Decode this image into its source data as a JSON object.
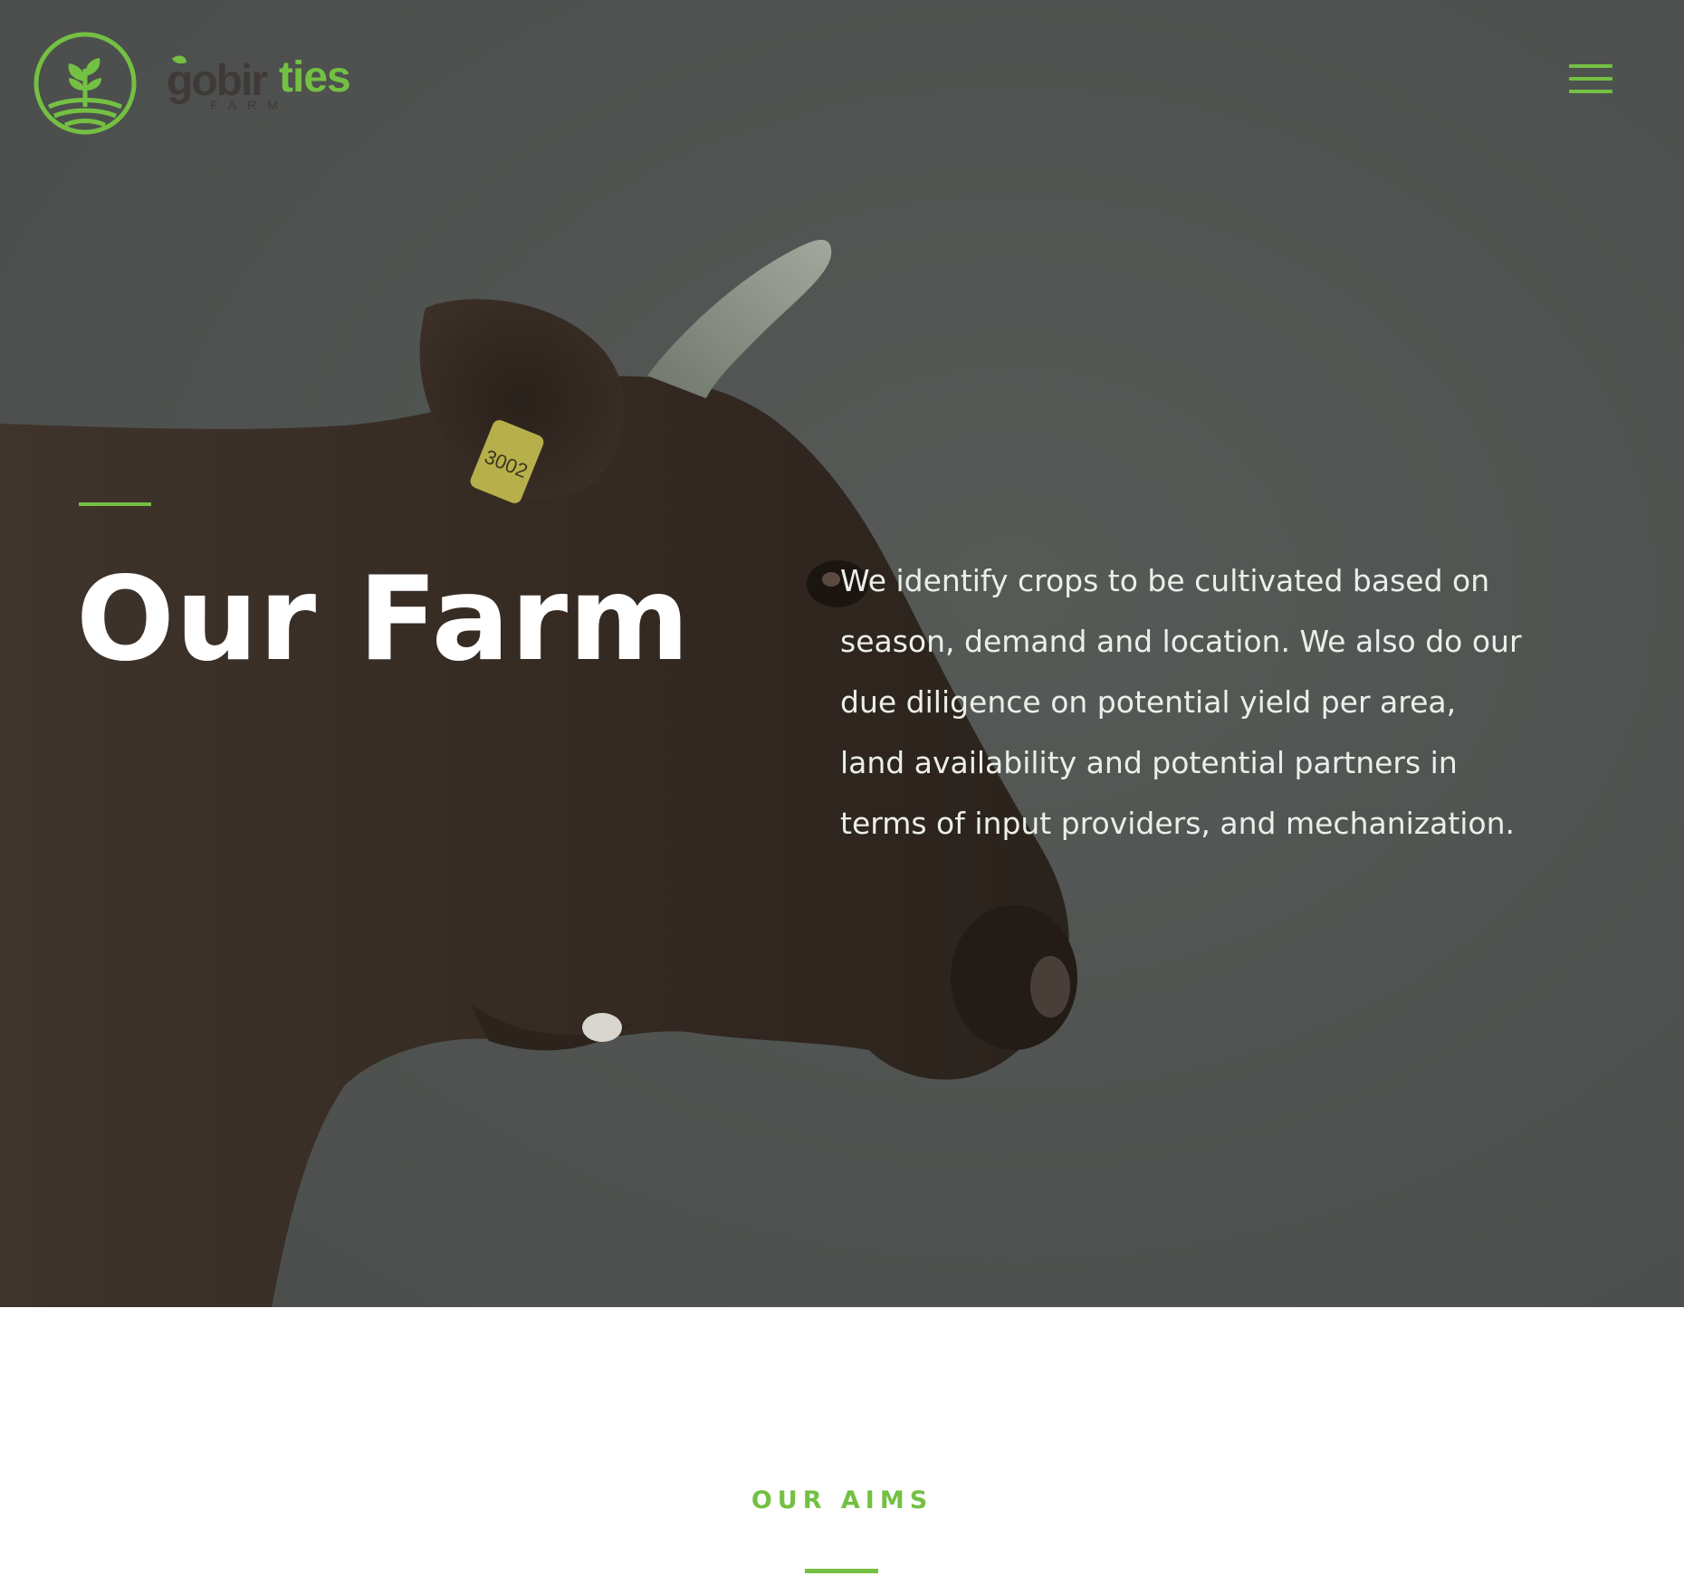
{
  "brand": {
    "name_green": "ties",
    "name_dark": "gobir",
    "tagline": "FARM",
    "accent_color": "#74c043",
    "dark_color": "#3f3a37"
  },
  "header": {
    "menu_icon": "hamburger-menu-icon"
  },
  "hero": {
    "title": "Our Farm",
    "description": "We identify crops to be cultivated based on season, demand and location. We also do our due diligence on potential yield per area, land availability and potential partners in terms of input providers, and mechanization.",
    "ear_tag": "3002",
    "overlay_color": "#4e514f"
  },
  "aims": {
    "label": "OUR AIMS"
  }
}
